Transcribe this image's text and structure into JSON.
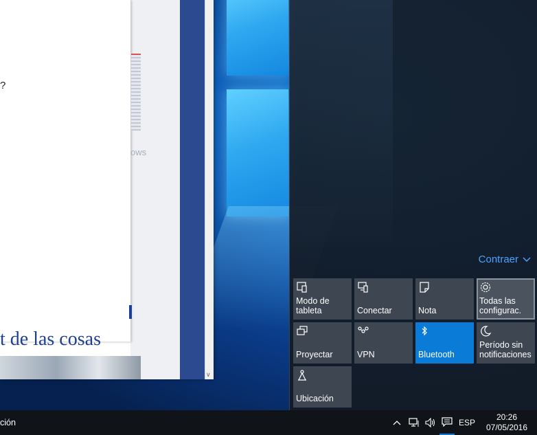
{
  "document_window": {
    "question_mark": "?",
    "ghost_text": "ows",
    "heading_fragment": "t de las cosas"
  },
  "action_center": {
    "collapse_label": "Contraer",
    "tiles": [
      {
        "label": "Modo de tableta",
        "icon": "tablet-mode-icon",
        "state": "off"
      },
      {
        "label": "Conectar",
        "icon": "connect-icon",
        "state": "off"
      },
      {
        "label": "Nota",
        "icon": "note-icon",
        "state": "off"
      },
      {
        "label": "Todas las configurac.",
        "icon": "gear-icon",
        "state": "selected"
      },
      {
        "label": "Proyectar",
        "icon": "project-icon",
        "state": "off"
      },
      {
        "label": "VPN",
        "icon": "vpn-icon",
        "state": "off"
      },
      {
        "label": "Bluetooth",
        "icon": "bluetooth-icon",
        "state": "on"
      },
      {
        "label": "Período sin notificaciones",
        "icon": "moon-icon",
        "state": "off"
      },
      {
        "label": "Ubicación",
        "icon": "location-icon",
        "state": "off"
      }
    ]
  },
  "taskbar": {
    "left_fragment": "ción",
    "language": "ESP",
    "time": "20:26",
    "date": "07/05/2016"
  },
  "colors": {
    "accent": "#0b7bd8",
    "tile": "#3d4651",
    "link": "#4aa3ff",
    "taskbar": "#101418"
  }
}
